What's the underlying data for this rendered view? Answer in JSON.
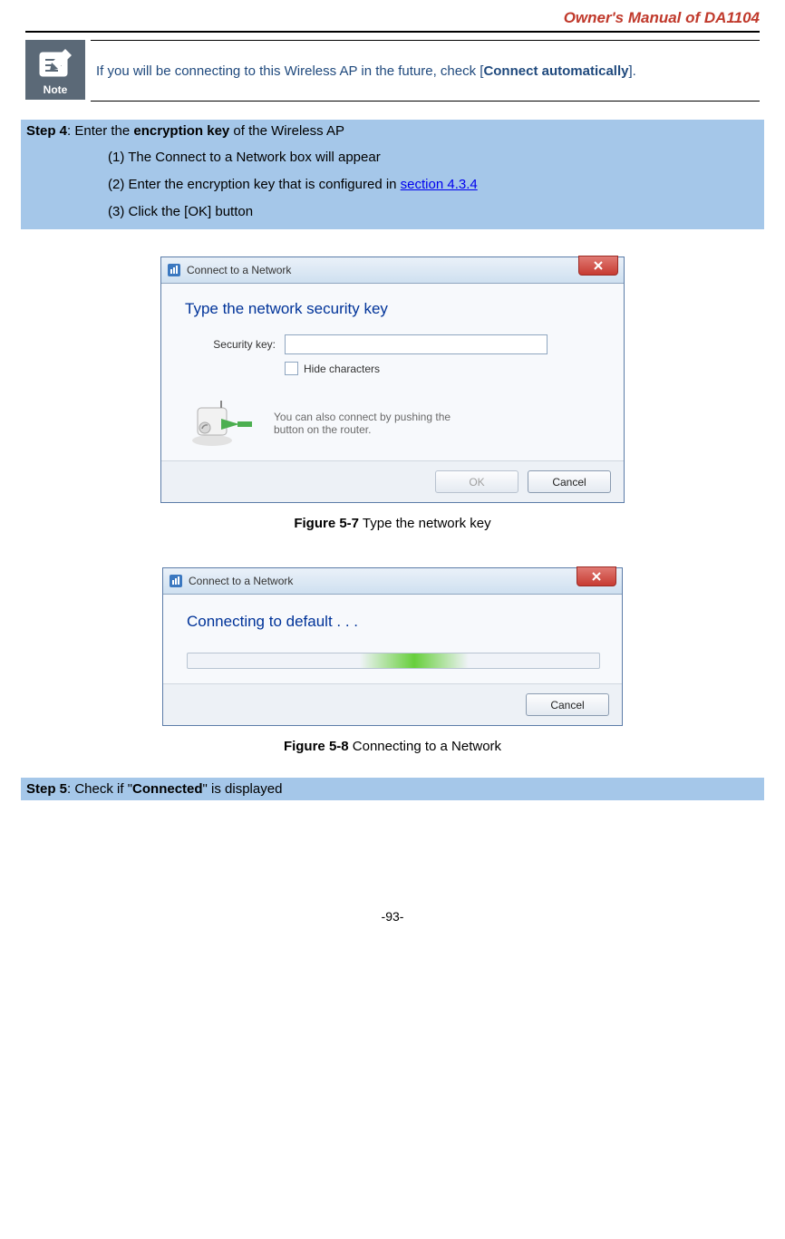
{
  "header": {
    "title": "Owner's Manual of DA1104"
  },
  "note": {
    "label": "Note",
    "text_prefix": "If you will be connecting to this Wireless AP in the future, check [",
    "text_bold": "Connect automatically",
    "text_suffix": "]."
  },
  "step4": {
    "label_bold": "Step 4",
    "label_rest": ": Enter the ",
    "label_bold2": "encryption key",
    "label_rest2": " of the Wireless AP",
    "items": [
      "(1)  The Connect to a Network box will appear",
      "(2)  Enter the encryption key that is configured in ",
      "(3)  Click the [OK] button"
    ],
    "link_text": "section 4.3.4"
  },
  "dialog1": {
    "title": "Connect to a Network",
    "heading": "Type the network security key",
    "security_label": "Security key:",
    "hide_chars": "Hide characters",
    "wps_text_l1": "You can also connect by pushing the",
    "wps_text_l2": "button on the router.",
    "ok": "OK",
    "cancel": "Cancel"
  },
  "fig1": {
    "bold": "Figure 5-7",
    "rest": " Type the network key"
  },
  "dialog2": {
    "title": "Connect to a Network",
    "heading": "Connecting to default . . .",
    "cancel": "Cancel"
  },
  "fig2": {
    "bold": "Figure 5-8",
    "rest": " Connecting to a Network"
  },
  "step5": {
    "label_bold": "Step 5",
    "label_rest": ": Check if \"",
    "label_bold2": "Connected",
    "label_rest2": "\" is displayed"
  },
  "page_number": "-93-"
}
